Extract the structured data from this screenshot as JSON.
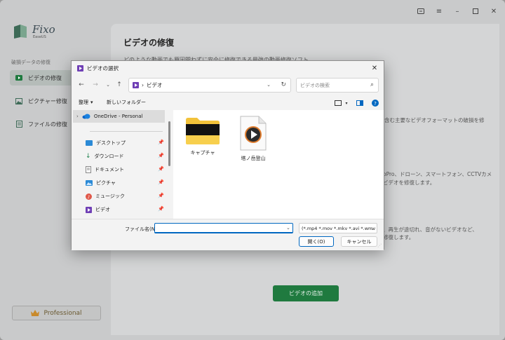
{
  "app": {
    "logo_name": "Fixo",
    "logo_sub": "EaseUS",
    "sidebar_label": "破損データの修復",
    "sidebar_items": [
      {
        "label": "ビデオの修復"
      },
      {
        "label": "ピクチャー修復"
      },
      {
        "label": "ファイルの修復"
      }
    ],
    "pro_label": "Professional",
    "colors": {
      "accent": "#1f7a3f",
      "pro": "#6a5930"
    }
  },
  "main": {
    "title": "ビデオの修復",
    "line1": "どのような動画でも原因問わずに安全に修復できる最強の動画修復ソフト",
    "frag1": "含む主要なビデオフォーマットの破損を修",
    "frag2": "oPro、ドローン、スマートフォン、CCTVカメ",
    "frag3": "ビデオを修復します。",
    "frag4": "、再生が途切れ、音がないビデオなど、",
    "frag5": "修復します。",
    "add_button": "ビデオの追加"
  },
  "dialog": {
    "title": "ビデオの選択",
    "address": "ビデオ",
    "search_placeholder": "ビデオの検索",
    "organize": "整理",
    "new_folder": "新しいフォルダー",
    "onedrive": "OneDrive - Personal",
    "nav_items": [
      {
        "label": "デスクトップ"
      },
      {
        "label": "ダウンロード"
      },
      {
        "label": "ドキュメント"
      },
      {
        "label": "ピクチャ"
      },
      {
        "label": "ミュージック"
      },
      {
        "label": "ビデオ"
      }
    ],
    "files": [
      {
        "name": "キャプチャ"
      },
      {
        "name": "塔ノ岳登山"
      }
    ],
    "filename_label": "ファイル名(N):",
    "filename_value": "",
    "filter": "(*.mp4 *.mov *.mkv *.avi *.wmv",
    "open_button": "開く(O)",
    "cancel_button": "キャンセル"
  }
}
